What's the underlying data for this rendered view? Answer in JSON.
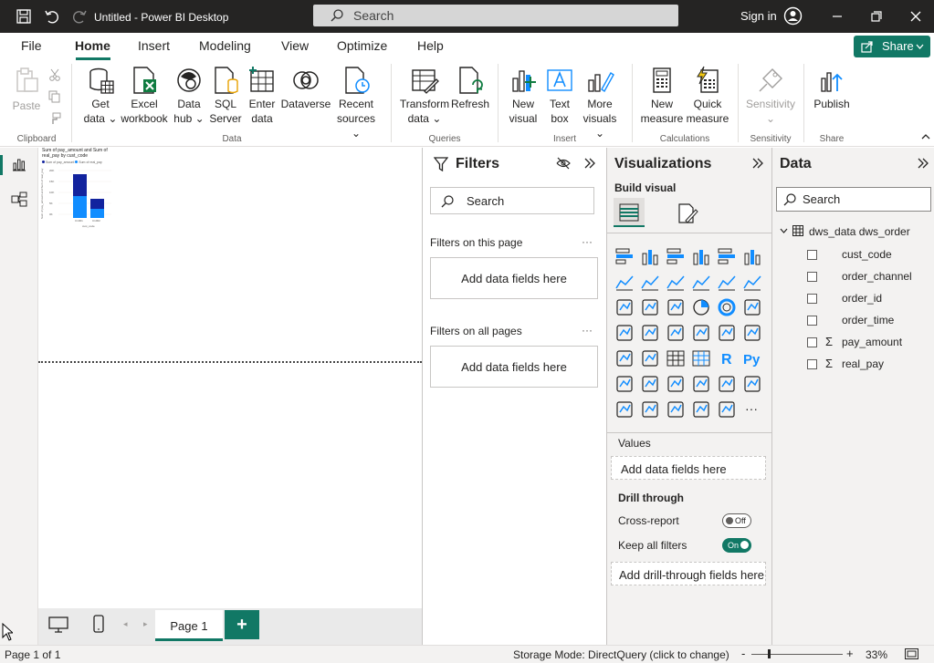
{
  "titlebar": {
    "title": "Untitled - Power BI Desktop",
    "search_placeholder": "Search",
    "sign_in": "Sign in"
  },
  "menu": {
    "file": "File",
    "home": "Home",
    "insert": "Insert",
    "modeling": "Modeling",
    "view": "View",
    "optimize": "Optimize",
    "help": "Help",
    "share": "Share"
  },
  "ribbon": {
    "paste": "Paste",
    "get_data": [
      "Get",
      "data"
    ],
    "excel": [
      "Excel",
      "workbook"
    ],
    "data_hub": [
      "Data",
      "hub"
    ],
    "sql": [
      "SQL",
      "Server"
    ],
    "enter_data": [
      "Enter",
      "data"
    ],
    "dataverse": "Dataverse",
    "recent": [
      "Recent",
      "sources"
    ],
    "transform": [
      "Transform",
      "data"
    ],
    "refresh": "Refresh",
    "new_visual": [
      "New",
      "visual"
    ],
    "text_box": [
      "Text",
      "box"
    ],
    "more_visuals": [
      "More",
      "visuals"
    ],
    "new_measure": [
      "New",
      "measure"
    ],
    "quick_measure": [
      "Quick",
      "measure"
    ],
    "sensitivity": "Sensitivity",
    "publish": "Publish",
    "groups": {
      "clipboard": "Clipboard",
      "data": "Data",
      "queries": "Queries",
      "insert": "Insert",
      "calculations": "Calculations",
      "sensitivity": "Sensitivity",
      "share": "Share"
    }
  },
  "chart": {
    "title": "Sum of pay_amount and Sum of real_pay by cust_code",
    "legend": [
      "Sum of pay_amount",
      "Sum of real_pay"
    ],
    "xlabel": "cust_code",
    "ylabel": "Sum of pay_amount and Sum of real_pay",
    "colors": [
      "#12239e",
      "#118dff"
    ]
  },
  "filters": {
    "title": "Filters",
    "search": "Search",
    "on_page": "Filters on this page",
    "on_all": "Filters on all pages",
    "add_fields": "Add data fields here",
    "more": "···"
  },
  "viz": {
    "title": "Visualizations",
    "build": "Build visual",
    "values": "Values",
    "add_fields": "Add data fields here",
    "drill": "Drill through",
    "cross_report": "Cross-report",
    "cross_state": "Off",
    "keep_filters": "Keep all filters",
    "keep_state": "On",
    "add_drill": "Add drill-through fields here",
    "more": "···"
  },
  "data": {
    "title": "Data",
    "search": "Search",
    "table": "dws_data dws_order",
    "fields": [
      {
        "name": "cust_code",
        "sigma": false
      },
      {
        "name": "order_channel",
        "sigma": false
      },
      {
        "name": "order_id",
        "sigma": false
      },
      {
        "name": "order_time",
        "sigma": false
      },
      {
        "name": "pay_amount",
        "sigma": true
      },
      {
        "name": "real_pay",
        "sigma": true
      }
    ]
  },
  "pages": {
    "tab": "Page 1",
    "add": "+"
  },
  "status": {
    "page": "Page 1 of 1",
    "storage": "Storage Mode: DirectQuery (click to change)",
    "zoom": "33%"
  }
}
